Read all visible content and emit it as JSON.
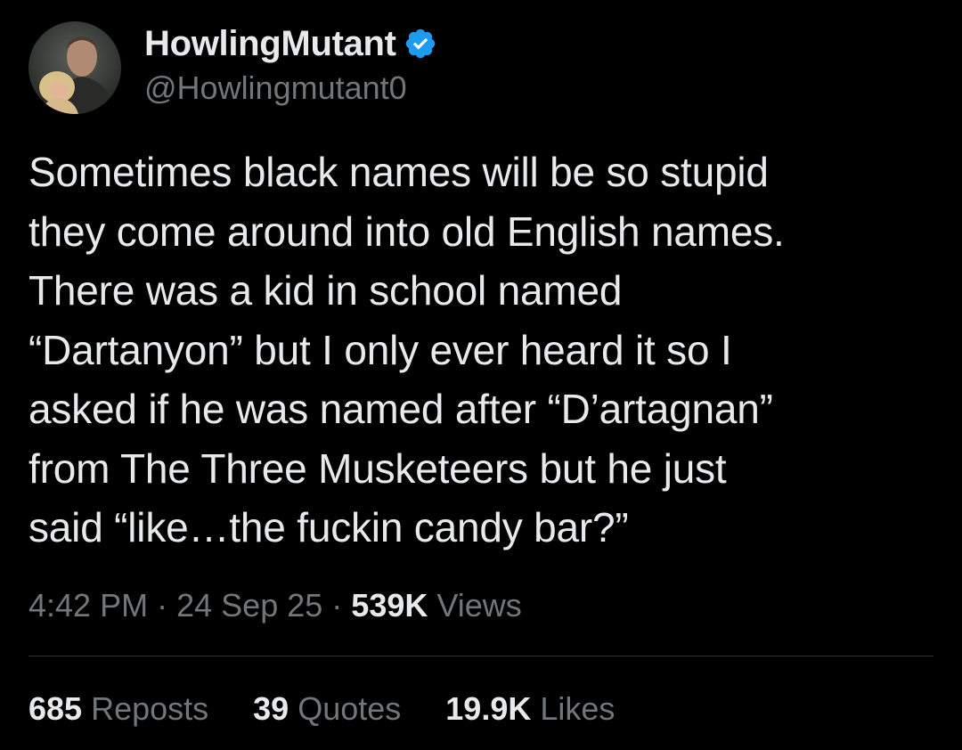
{
  "author": {
    "display_name": "HowlingMutant",
    "handle": "@Howlingmutant0",
    "avatar": "profile-photo",
    "verified_icon": "verified-badge-icon"
  },
  "tweet": {
    "text": "Sometimes black names will be so stupid\nthey come around into old English names.\nThere was a kid in school named\n“Dartanyon” but I only ever heard it so I\nasked if he was named after “D’artagnan”\nfrom The Three Musketeers but he just\nsaid “like…the fuckin candy bar?”",
    "time": "4:42 PM",
    "separator": "·",
    "date": "24 Sep 25",
    "views_count": "539K",
    "views_label": "Views"
  },
  "stats": [
    {
      "count": "685",
      "label": "Reposts"
    },
    {
      "count": "39",
      "label": "Quotes"
    },
    {
      "count": "19.9K",
      "label": "Likes"
    }
  ],
  "colors": {
    "background": "#000000",
    "primary_text": "#e7e9ea",
    "secondary_text": "#71767b",
    "verified_blue": "#1d9bf0",
    "divider": "#2f3336"
  }
}
